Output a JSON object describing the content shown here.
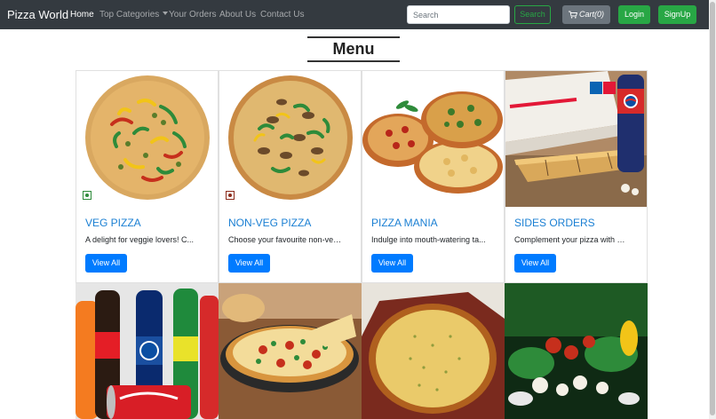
{
  "navbar": {
    "brand": "Pizza World",
    "links": {
      "home": "Home",
      "top_categories": "Top Categories",
      "your_orders": "Your Orders",
      "about_us": "About Us",
      "contact_us": "Contact Us"
    },
    "search": {
      "placeholder": "Search",
      "button": "Search"
    },
    "cart": {
      "label": "Cart(0)",
      "count": 0
    },
    "login": "Login",
    "signup": "SignUp"
  },
  "page": {
    "heading": "Menu"
  },
  "categories": [
    {
      "title": "VEG PIZZA",
      "description": "A delight for veggie lovers! C...",
      "button": "View All"
    },
    {
      "title": "NON-VEG PIZZA",
      "description": "Choose your favourite non-veg ...",
      "button": "View All"
    },
    {
      "title": "PIZZA MANIA",
      "description": "Indulge into mouth-watering ta...",
      "button": "View All"
    },
    {
      "title": "SIDES ORDERS",
      "description": "Complement your pizza with wid...",
      "button": "View All"
    }
  ],
  "colors": {
    "navbar_bg": "#343a40",
    "success": "#28a745",
    "primary": "#007bff",
    "title_blue": "#1a7fd3",
    "veg": "#2e8b3a",
    "nonveg": "#8b2a1a"
  },
  "icons": {
    "cart": "cart-icon",
    "caret": "chevron-down-icon",
    "veg": "veg-mark-icon",
    "nonveg": "nonveg-mark-icon"
  }
}
